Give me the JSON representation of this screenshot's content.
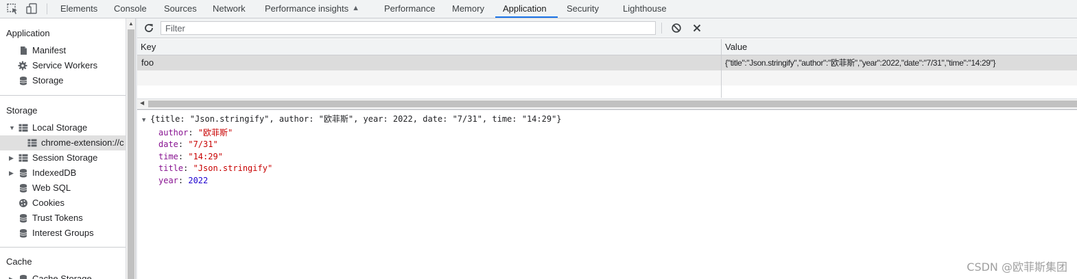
{
  "tabs": [
    {
      "label": "Elements"
    },
    {
      "label": "Console"
    },
    {
      "label": "Sources"
    },
    {
      "label": "Network"
    },
    {
      "label": "Performance insights"
    },
    {
      "label": "Performance"
    },
    {
      "label": "Memory"
    },
    {
      "label": "Application"
    },
    {
      "label": "Security"
    },
    {
      "label": "Lighthouse"
    }
  ],
  "active_tab": "Application",
  "sidebar": {
    "sections": [
      {
        "title": "Application",
        "items": [
          {
            "label": "Manifest",
            "icon": "document-icon"
          },
          {
            "label": "Service Workers",
            "icon": "gear-icon"
          },
          {
            "label": "Storage",
            "icon": "database-icon"
          }
        ]
      },
      {
        "title": "Storage",
        "items": [
          {
            "label": "Local Storage",
            "icon": "grid-icon",
            "expanded": true
          },
          {
            "label": "chrome-extension://c",
            "icon": "grid-icon",
            "selected": true
          },
          {
            "label": "Session Storage",
            "icon": "grid-icon"
          },
          {
            "label": "IndexedDB",
            "icon": "database-icon"
          },
          {
            "label": "Web SQL",
            "icon": "database-icon"
          },
          {
            "label": "Cookies",
            "icon": "cookie-icon"
          },
          {
            "label": "Trust Tokens",
            "icon": "database-icon"
          },
          {
            "label": "Interest Groups",
            "icon": "database-icon"
          }
        ]
      },
      {
        "title": "Cache",
        "items": [
          {
            "label": "Cache Storage",
            "icon": "database-icon"
          }
        ]
      }
    ]
  },
  "toolbar": {
    "filter_placeholder": "Filter",
    "filter_value": ""
  },
  "table": {
    "columns": [
      "Key",
      "Value"
    ],
    "rows": [
      {
        "key": "foo",
        "value": "{\"title\":\"Json.stringify\",\"author\":\"欧菲斯\",\"year\":2022,\"date\":\"7/31\",\"time\":\"14:29\"}"
      }
    ]
  },
  "preview": {
    "summary": "{title: \"Json.stringify\", author: \"欧菲斯\", year: 2022, date: \"7/31\", time: \"14:29\"}",
    "fields": [
      {
        "key": "author",
        "value": "\"欧菲斯\"",
        "type": "string"
      },
      {
        "key": "date",
        "value": "\"7/31\"",
        "type": "string"
      },
      {
        "key": "time",
        "value": "\"14:29\"",
        "type": "string"
      },
      {
        "key": "title",
        "value": "\"Json.stringify\"",
        "type": "string"
      },
      {
        "key": "year",
        "value": "2022",
        "type": "number"
      }
    ]
  },
  "watermark": "CSDN @欧菲斯集团",
  "colors": {
    "accent": "#1a73e8",
    "string": "#c80000",
    "key": "#881391",
    "number": "#1c00cf"
  }
}
